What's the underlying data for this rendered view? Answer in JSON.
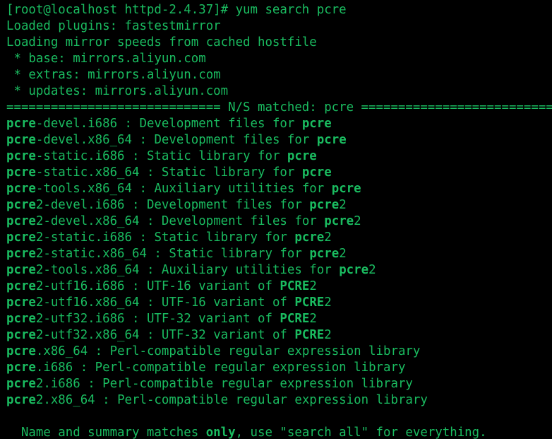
{
  "terminal": {
    "colors": {
      "background": "#000000",
      "text": "#1abc60"
    },
    "lines": [
      {
        "kind": "plain",
        "text": "[root@localhost httpd-2.4.37]# yum search pcre"
      },
      {
        "kind": "plain",
        "text": "Loaded plugins: fastestmirror"
      },
      {
        "kind": "plain",
        "text": "Loading mirror speeds from cached hostfile"
      },
      {
        "kind": "plain",
        "text": " * base: mirrors.aliyun.com"
      },
      {
        "kind": "plain",
        "text": " * extras: mirrors.aliyun.com"
      },
      {
        "kind": "plain",
        "text": " * updates: mirrors.aliyun.com"
      },
      {
        "kind": "plain",
        "text": "============================= N/S matched: pcre ============================="
      },
      {
        "kind": "result",
        "hl": "pcre",
        "pkg_rest": "-devel.i686",
        "sep": " : ",
        "desc": "Development files for ",
        "desc_hl": "pcre",
        "desc_tail": ""
      },
      {
        "kind": "result",
        "hl": "pcre",
        "pkg_rest": "-devel.x86_64",
        "sep": " : ",
        "desc": "Development files for ",
        "desc_hl": "pcre",
        "desc_tail": ""
      },
      {
        "kind": "result",
        "hl": "pcre",
        "pkg_rest": "-static.i686",
        "sep": " : ",
        "desc": "Static library for ",
        "desc_hl": "pcre",
        "desc_tail": ""
      },
      {
        "kind": "result",
        "hl": "pcre",
        "pkg_rest": "-static.x86_64",
        "sep": " : ",
        "desc": "Static library for ",
        "desc_hl": "pcre",
        "desc_tail": ""
      },
      {
        "kind": "result",
        "hl": "pcre",
        "pkg_rest": "-tools.x86_64",
        "sep": " : ",
        "desc": "Auxiliary utilities for ",
        "desc_hl": "pcre",
        "desc_tail": ""
      },
      {
        "kind": "result",
        "hl": "pcre",
        "pkg_rest": "2-devel.i686",
        "sep": " : ",
        "desc": "Development files for ",
        "desc_hl": "pcre",
        "desc_tail": "2"
      },
      {
        "kind": "result",
        "hl": "pcre",
        "pkg_rest": "2-devel.x86_64",
        "sep": " : ",
        "desc": "Development files for ",
        "desc_hl": "pcre",
        "desc_tail": "2"
      },
      {
        "kind": "result",
        "hl": "pcre",
        "pkg_rest": "2-static.i686",
        "sep": " : ",
        "desc": "Static library for ",
        "desc_hl": "pcre",
        "desc_tail": "2"
      },
      {
        "kind": "result",
        "hl": "pcre",
        "pkg_rest": "2-static.x86_64",
        "sep": " : ",
        "desc": "Static library for ",
        "desc_hl": "pcre",
        "desc_tail": "2"
      },
      {
        "kind": "result",
        "hl": "pcre",
        "pkg_rest": "2-tools.x86_64",
        "sep": " : ",
        "desc": "Auxiliary utilities for ",
        "desc_hl": "pcre",
        "desc_tail": "2"
      },
      {
        "kind": "result",
        "hl": "pcre",
        "pkg_rest": "2-utf16.i686",
        "sep": " : ",
        "desc": "UTF-16 variant of ",
        "desc_hl": "PCRE",
        "desc_tail": "2"
      },
      {
        "kind": "result",
        "hl": "pcre",
        "pkg_rest": "2-utf16.x86_64",
        "sep": " : ",
        "desc": "UTF-16 variant of ",
        "desc_hl": "PCRE",
        "desc_tail": "2"
      },
      {
        "kind": "result",
        "hl": "pcre",
        "pkg_rest": "2-utf32.i686",
        "sep": " : ",
        "desc": "UTF-32 variant of ",
        "desc_hl": "PCRE",
        "desc_tail": "2"
      },
      {
        "kind": "result",
        "hl": "pcre",
        "pkg_rest": "2-utf32.x86_64",
        "sep": " : ",
        "desc": "UTF-32 variant of ",
        "desc_hl": "PCRE",
        "desc_tail": "2"
      },
      {
        "kind": "result",
        "hl": "pcre",
        "pkg_rest": ".x86_64",
        "sep": " : ",
        "desc": "Perl-compatible regular expression library",
        "desc_hl": "",
        "desc_tail": ""
      },
      {
        "kind": "result",
        "hl": "pcre",
        "pkg_rest": ".i686",
        "sep": " : ",
        "desc": "Perl-compatible regular expression library",
        "desc_hl": "",
        "desc_tail": ""
      },
      {
        "kind": "result",
        "hl": "pcre",
        "pkg_rest": "2.i686",
        "sep": " : ",
        "desc": "Perl-compatible regular expression library",
        "desc_hl": "",
        "desc_tail": ""
      },
      {
        "kind": "result",
        "hl": "pcre",
        "pkg_rest": "2.x86_64",
        "sep": " : ",
        "desc": "Perl-compatible regular expression library",
        "desc_hl": "",
        "desc_tail": ""
      },
      {
        "kind": "blank"
      },
      {
        "kind": "footer",
        "pre": "  Name and summary matches ",
        "hl": "only",
        "post": ", use \"search all\" for everything."
      }
    ]
  }
}
